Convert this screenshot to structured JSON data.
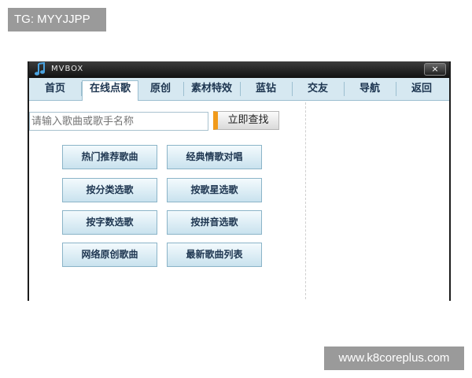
{
  "watermark_top": "TG: MYYJJPP",
  "watermark_bottom": "www.k8coreplus.com",
  "window": {
    "title": "MVBOX",
    "app_icon": "music-note-icon",
    "close_label": "×"
  },
  "nav": {
    "tabs": [
      "首页",
      "在线点歌",
      "原创",
      "素材特效",
      "蓝钻",
      "交友",
      "导航",
      "返回"
    ],
    "active": "在线点歌"
  },
  "search": {
    "placeholder": "请输入歌曲或歌手名称",
    "button_label": "立即查找",
    "button_accent": "#f19a1a"
  },
  "categories": [
    "热门推荐歌曲",
    "经典情歌对唱",
    "按分类选歌",
    "按歌星选歌",
    "按字数选歌",
    "按拼音选歌",
    "网络原创歌曲",
    "最新歌曲列表"
  ]
}
